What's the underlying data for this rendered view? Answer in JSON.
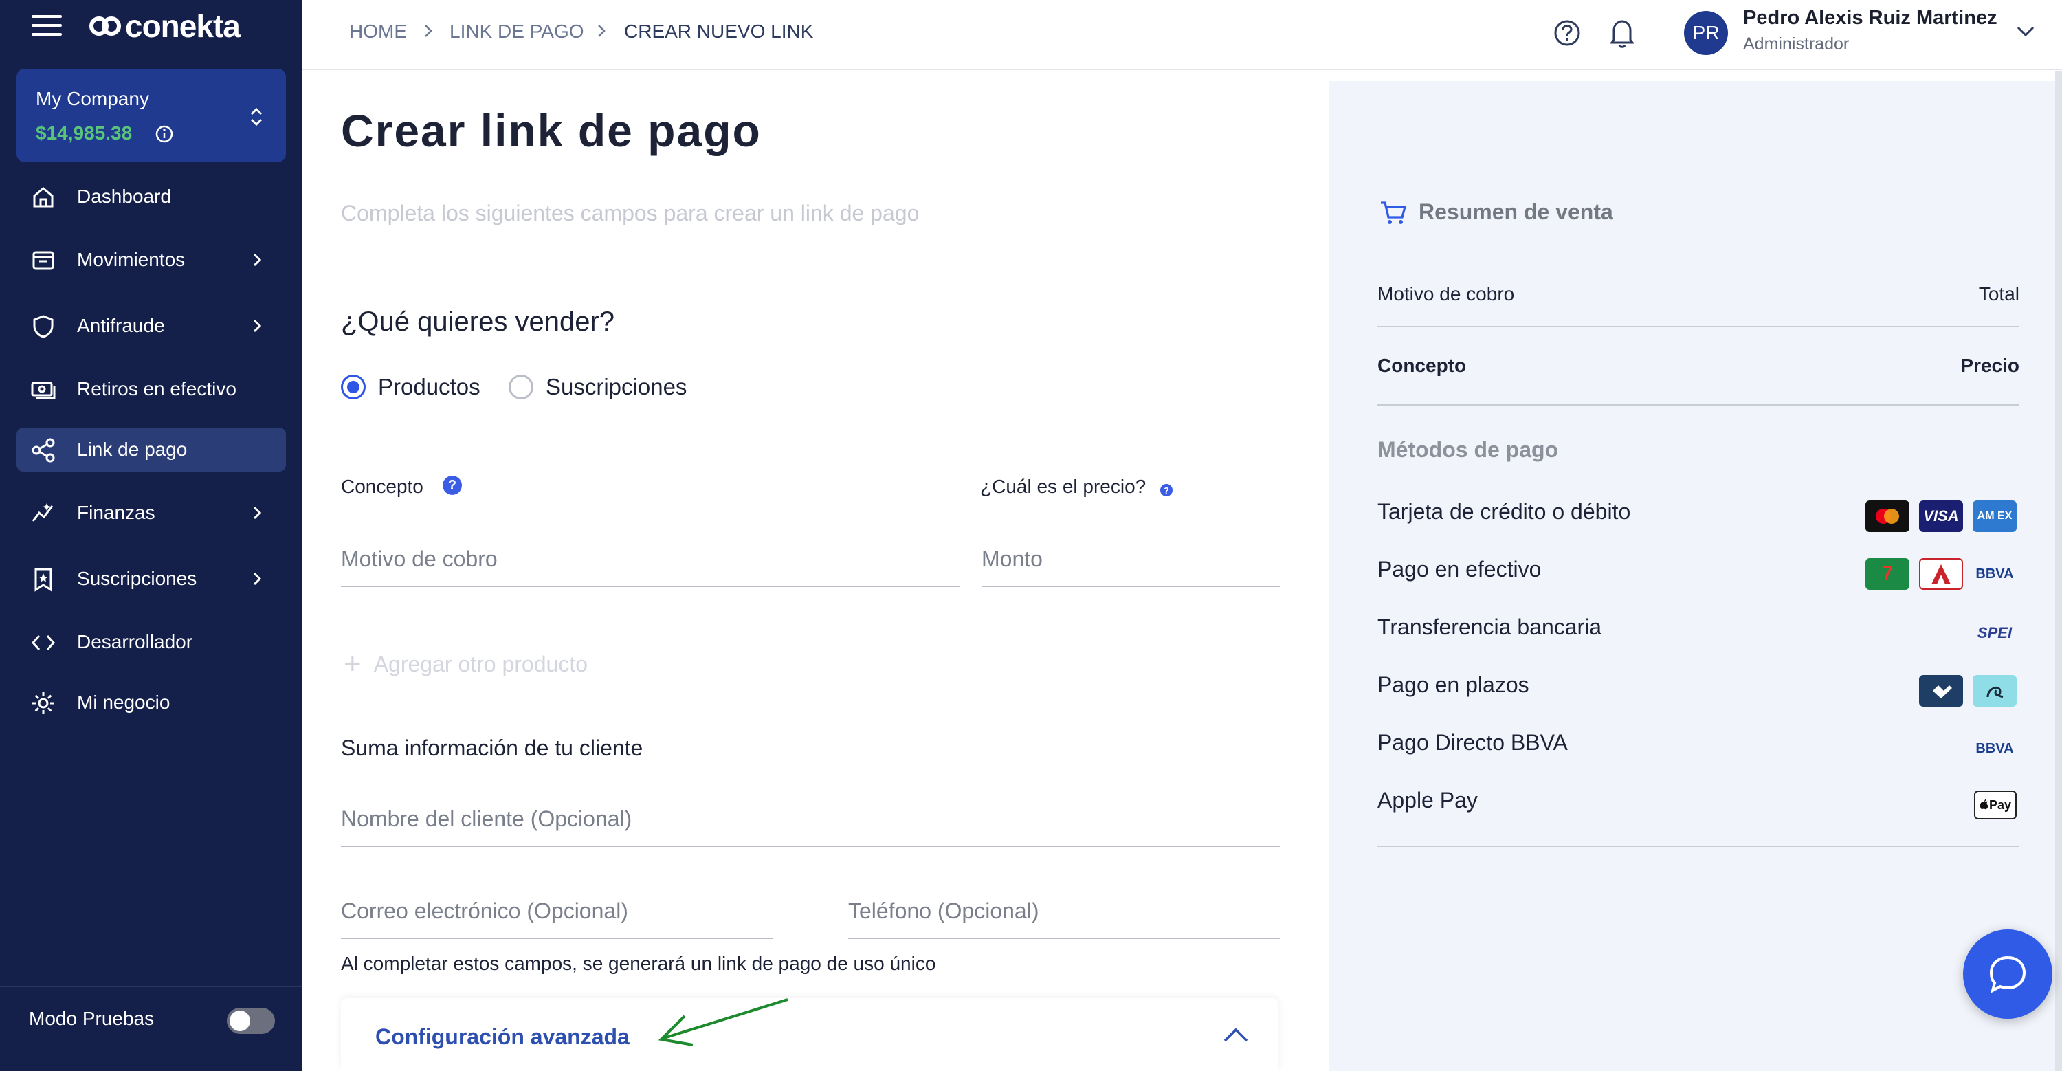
{
  "sidebar": {
    "brand": "conekta",
    "company": {
      "name": "My Company",
      "balance": "$14,985.38"
    },
    "items": [
      {
        "label": "Dashboard",
        "icon": "home-icon"
      },
      {
        "label": "Movimientos",
        "icon": "inbox-icon"
      },
      {
        "label": "Antifraude",
        "icon": "shield-icon"
      },
      {
        "label": "Retiros en efectivo",
        "icon": "cash-icon"
      },
      {
        "label": "Link de pago",
        "icon": "share-icon",
        "active": true
      },
      {
        "label": "Finanzas",
        "icon": "sparkline-icon"
      },
      {
        "label": "Suscripciones",
        "icon": "bookmark-star-icon"
      },
      {
        "label": "Desarrollador",
        "icon": "code-icon"
      },
      {
        "label": "Mi negocio",
        "icon": "gear-icon"
      }
    ],
    "test_mode_label": "Modo Pruebas"
  },
  "breadcrumb": [
    "HOME",
    "LINK DE PAGO",
    "CREAR NUEVO LINK"
  ],
  "user": {
    "initials": "PR",
    "name": "Pedro Alexis Ruiz Martinez",
    "role": "Administrador"
  },
  "main": {
    "title": "Crear link de pago",
    "subtitle": "Completa los siguientes campos para crear un link de pago",
    "question": "¿Qué quieres vender?",
    "options": [
      "Productos",
      "Suscripciones"
    ],
    "selected_option": "Productos",
    "concept_label": "Concepto",
    "concept_placeholder": "Motivo de cobro",
    "price_label": "¿Cuál es el precio?",
    "price_placeholder": "Monto",
    "add_product": "Agregar otro producto",
    "client_section": "Suma información de tu cliente",
    "client_name_placeholder": "Nombre del cliente (Opcional)",
    "email_placeholder": "Correo electrónico (Opcional)",
    "phone_placeholder": "Teléfono (Opcional)",
    "note": "Al completar estos campos, se generará un link de pago de uso único",
    "advanced": "Configuración avanzada"
  },
  "summary": {
    "title": "Resumen de venta",
    "row1_left": "Motivo de cobro",
    "row1_right": "Total",
    "row2_left": "Concepto",
    "row2_right": "Precio",
    "methods_title": "Métodos de pago",
    "methods": [
      "Tarjeta de crédito o débito",
      "Pago en efectivo",
      "Transferencia bancaria",
      "Pago en plazos",
      "Pago Directo BBVA",
      "Apple Pay"
    ],
    "logos": {
      "visa": "VISA",
      "amex": "AM EX",
      "seven_eleven": "7",
      "bbva": "BBVA",
      "spei": "SPEI",
      "applepay": "Pay"
    }
  },
  "colors": {
    "sidebar_bg": "#14204a",
    "company_bg": "#203a8f",
    "active_item": "#2b3d77",
    "balance_green": "#59c57a",
    "accent_blue": "#2e55e6",
    "panel_bg": "#f1f5fb"
  }
}
